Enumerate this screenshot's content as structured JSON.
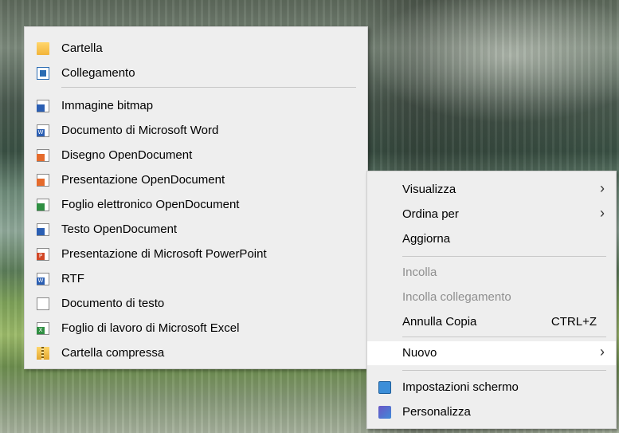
{
  "new_submenu": {
    "items": [
      {
        "label": "Cartella",
        "icon": "folder-icon"
      },
      {
        "label": "Collegamento",
        "icon": "shortcut-icon"
      },
      {
        "label": "Immagine bitmap",
        "icon": "bitmap-image-icon"
      },
      {
        "label": "Documento di Microsoft Word",
        "icon": "word-document-icon"
      },
      {
        "label": "Disegno OpenDocument",
        "icon": "opendocument-drawing-icon"
      },
      {
        "label": "Presentazione OpenDocument",
        "icon": "opendocument-presentation-icon"
      },
      {
        "label": "Foglio elettronico OpenDocument",
        "icon": "opendocument-spreadsheet-icon"
      },
      {
        "label": "Testo OpenDocument",
        "icon": "opendocument-text-icon"
      },
      {
        "label": "Presentazione di Microsoft PowerPoint",
        "icon": "powerpoint-presentation-icon"
      },
      {
        "label": "RTF",
        "icon": "rtf-document-icon"
      },
      {
        "label": "Documento di testo",
        "icon": "text-document-icon"
      },
      {
        "label": "Foglio di lavoro di Microsoft Excel",
        "icon": "excel-worksheet-icon"
      },
      {
        "label": "Cartella compressa",
        "icon": "zip-folder-icon"
      }
    ]
  },
  "context_menu": {
    "items": [
      {
        "label": "Visualizza",
        "has_submenu": true
      },
      {
        "label": "Ordina per",
        "has_submenu": true
      },
      {
        "label": "Aggiorna"
      },
      {
        "label": "Incolla",
        "disabled": true
      },
      {
        "label": "Incolla collegamento",
        "disabled": true
      },
      {
        "label": "Annulla Copia",
        "shortcut": "CTRL+Z"
      },
      {
        "label": "Nuovo",
        "has_submenu": true,
        "highlighted": true
      },
      {
        "label": "Impostazioni schermo",
        "icon": "display-settings-icon"
      },
      {
        "label": "Personalizza",
        "icon": "personalize-icon"
      }
    ],
    "arrow_glyph": "›"
  },
  "colors": {
    "menu_background": "#eeeeee",
    "highlight": "#ffffff",
    "disabled_text": "#8f8f8f"
  }
}
